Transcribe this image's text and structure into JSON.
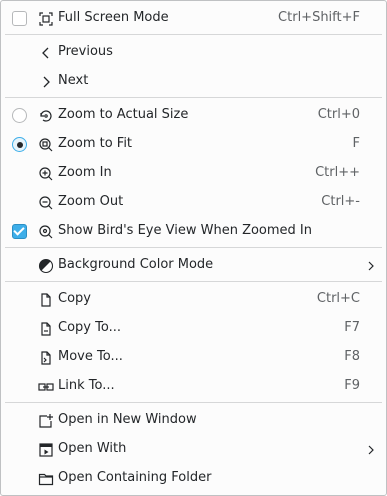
{
  "menu": {
    "full_screen": {
      "label": "Full Screen Mode",
      "shortcut": "Ctrl+Shift+F",
      "icon": "fullscreen-icon"
    },
    "previous": {
      "label": "Previous",
      "icon": "chevron-left-icon"
    },
    "next": {
      "label": "Next",
      "icon": "chevron-right-icon"
    },
    "zoom_actual": {
      "label": "Zoom to Actual Size",
      "shortcut": "Ctrl+0",
      "icon": "zoom-original-icon"
    },
    "zoom_fit": {
      "label": "Zoom to Fit",
      "shortcut": "F",
      "icon": "zoom-fit-icon"
    },
    "zoom_in": {
      "label": "Zoom In",
      "shortcut": "Ctrl++",
      "icon": "zoom-in-icon"
    },
    "zoom_out": {
      "label": "Zoom Out",
      "shortcut": "Ctrl+-",
      "icon": "zoom-out-icon"
    },
    "birds_eye": {
      "label": "Show Bird's Eye View When Zoomed In",
      "icon": "zoom-icon"
    },
    "background_color": {
      "label": "Background Color Mode",
      "icon": "color-mode-icon"
    },
    "copy": {
      "label": "Copy",
      "shortcut": "Ctrl+C",
      "icon": "copy-icon"
    },
    "copy_to": {
      "label": "Copy To...",
      "shortcut": "F7",
      "icon": "copy-to-icon"
    },
    "move_to": {
      "label": "Move To...",
      "shortcut": "F8",
      "icon": "move-to-icon"
    },
    "link_to": {
      "label": "Link To...",
      "shortcut": "F9",
      "icon": "link-icon"
    },
    "open_window": {
      "label": "Open in New Window",
      "icon": "new-window-icon"
    },
    "open_with": {
      "label": "Open With",
      "icon": "open-with-icon"
    },
    "open_folder": {
      "label": "Open Containing Folder",
      "icon": "folder-icon"
    }
  },
  "state": {
    "full_screen_checked": false,
    "zoom_mode_selected": "Zoom to Fit",
    "birds_eye_checked": true
  },
  "colors": {
    "accent": "#3daee9",
    "text": "#232629",
    "shortcut": "#5f6265",
    "separator": "#d6d7d8"
  }
}
